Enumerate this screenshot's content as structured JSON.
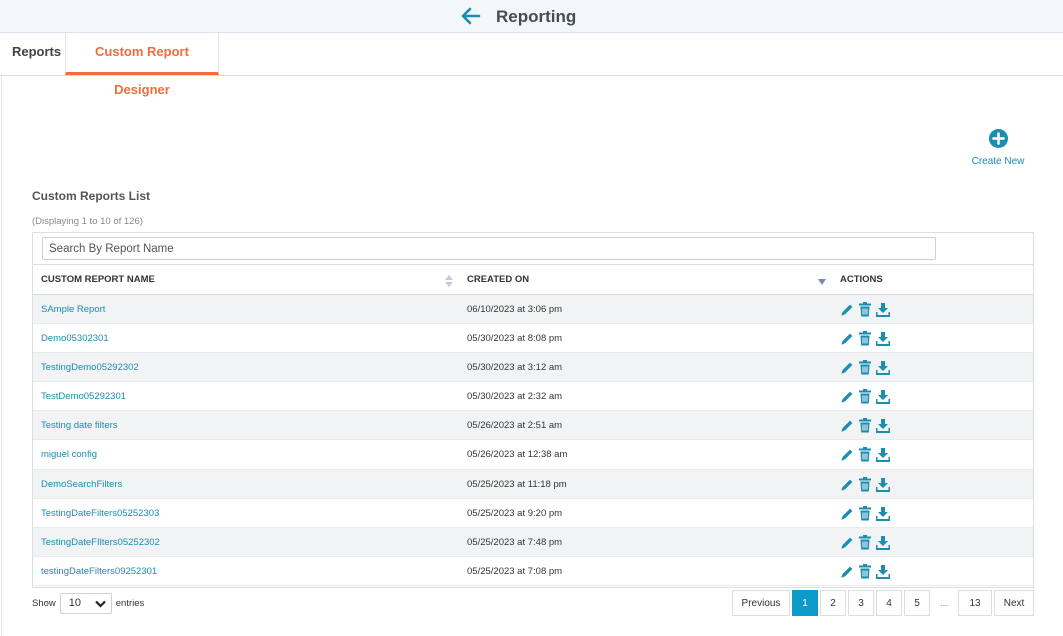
{
  "header": {
    "title": "Reporting",
    "back_icon": "arrow-left-icon"
  },
  "tabs": [
    {
      "label": "Reports",
      "active": false
    },
    {
      "label": "Custom Report Designer",
      "active": true
    }
  ],
  "create_new": {
    "label": "Create New",
    "icon": "plus-circle-icon"
  },
  "list": {
    "title": "Custom Reports List",
    "count_text": "(Displaying 1 to 10 of 126)",
    "search_placeholder": "Search By Report Name"
  },
  "table": {
    "columns": [
      "CUSTOM REPORT NAME",
      "CREATED ON",
      "ACTIONS"
    ],
    "rows": [
      {
        "name": "SAmple Report",
        "created": "06/10/2023 at 3:06 pm"
      },
      {
        "name": "Demo05302301",
        "created": "05/30/2023 at 8:08 pm"
      },
      {
        "name": "TestingDemo05292302",
        "created": "05/30/2023 at 3:12 am"
      },
      {
        "name": "TestDemo05292301",
        "created": "05/30/2023 at 2:32 am"
      },
      {
        "name": "Testing date filters",
        "created": "05/26/2023 at 2:51 am"
      },
      {
        "name": "miguel config",
        "created": "05/26/2023 at 12:38 am"
      },
      {
        "name": "DemoSearchFilters",
        "created": "05/25/2023 at 11:18 pm"
      },
      {
        "name": "TestingDateFilters05252303",
        "created": "05/25/2023 at 9:20 pm"
      },
      {
        "name": "TestingDateFIlters05252302",
        "created": "05/25/2023 at 7:48 pm"
      },
      {
        "name": "testingDateFilters09252301",
        "created": "05/25/2023 at 7:08 pm"
      }
    ],
    "row_actions": [
      "pencil-icon",
      "trash-icon",
      "download-icon"
    ]
  },
  "footer": {
    "show_label": "Show",
    "entries_value": "10",
    "entries_label": "entries",
    "pagination": [
      "Previous",
      "1",
      "2",
      "3",
      "4",
      "5",
      "...",
      "13",
      "Next"
    ],
    "current_page": "1"
  },
  "colors": {
    "accent": "#1a8db0",
    "active_tab": "#f26c3d",
    "page_active": "#0d9ac9"
  }
}
